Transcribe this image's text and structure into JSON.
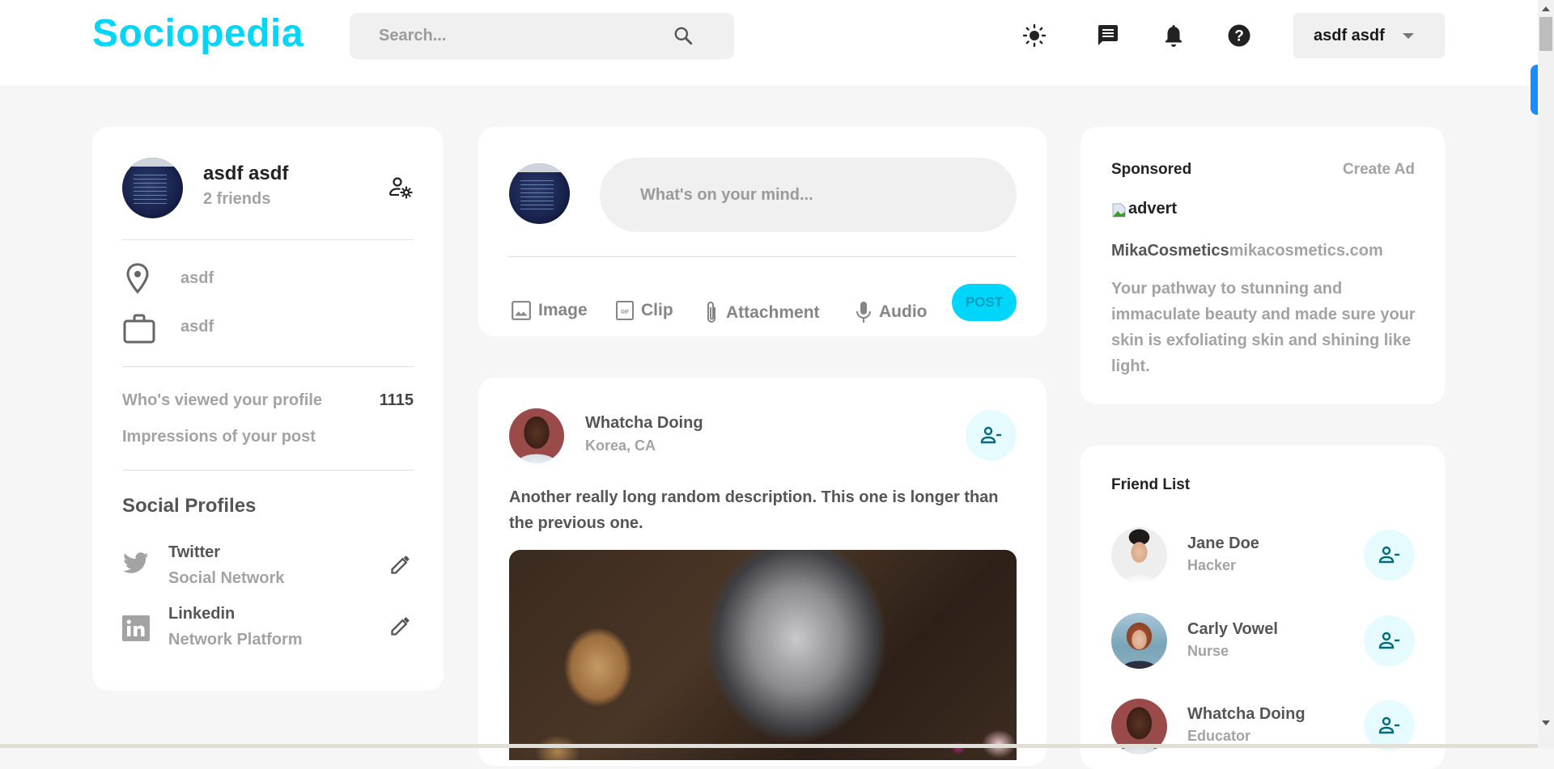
{
  "navbar": {
    "logo": "Sociopedia",
    "search_placeholder": "Search...",
    "icons": [
      "sun-icon",
      "message-icon",
      "bell-icon",
      "help-icon"
    ],
    "user_menu_label": "asdf asdf",
    "accent_color": "#00d5fa"
  },
  "profile_widget": {
    "name": "asdf asdf",
    "friends": "2 friends",
    "location": "asdf",
    "occupation": "asdf",
    "viewed_label": "Who's viewed your profile",
    "viewed_count": "1115",
    "impressions_label": "Impressions of your post",
    "impressions_count": "",
    "social_title": "Social Profiles",
    "socials": [
      {
        "name": "Twitter",
        "desc": "Social Network"
      },
      {
        "name": "Linkedin",
        "desc": "Network Platform"
      }
    ]
  },
  "composer": {
    "placeholder": "What's on your mind...",
    "actions": [
      "Image",
      "Clip",
      "Attachment",
      "Audio"
    ],
    "post_label": "POST"
  },
  "post": {
    "author": "Whatcha Doing",
    "location": "Korea, CA",
    "description": "Another really long random description. This one is longer than the previous one."
  },
  "sponsored": {
    "title": "Sponsored",
    "create_ad": "Create Ad",
    "image_alt": "advert",
    "brand": "MikaCosmetics",
    "url": "mikacosmetics.com",
    "text": "Your pathway to stunning and immaculate beauty and made sure your skin is exfoliating skin and shining like light."
  },
  "friend_list": {
    "title": "Friend List",
    "friends": [
      {
        "name": "Jane Doe",
        "role": "Hacker"
      },
      {
        "name": "Carly Vowel",
        "role": "Nurse"
      },
      {
        "name": "Whatcha Doing",
        "role": "Educator"
      }
    ]
  }
}
